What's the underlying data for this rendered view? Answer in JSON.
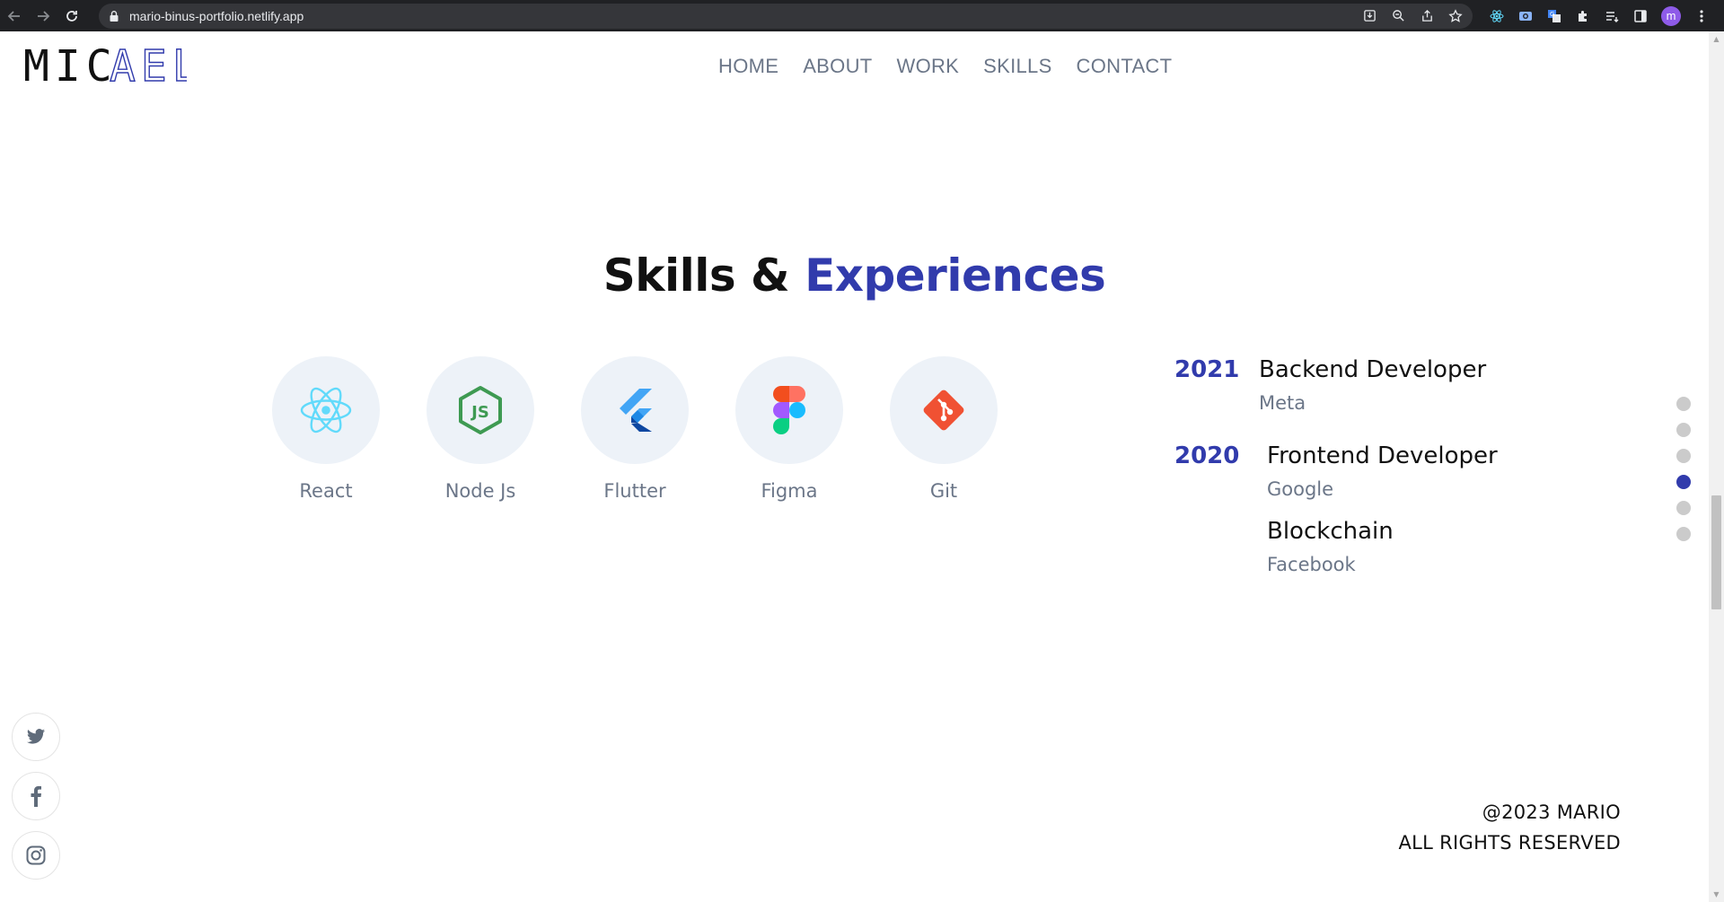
{
  "browser": {
    "url": "mario-binus-portfolio.netlify.app"
  },
  "logo": {
    "text_dark": "MIC",
    "text_accent": "AEL"
  },
  "nav": {
    "items": [
      {
        "label": "HOME"
      },
      {
        "label": "ABOUT"
      },
      {
        "label": "WORK"
      },
      {
        "label": "SKILLS"
      },
      {
        "label": "CONTACT"
      }
    ]
  },
  "section": {
    "title_main": "Skills &",
    "title_accent": "Experiences"
  },
  "skills": [
    {
      "name": "React",
      "icon": "react-icon"
    },
    {
      "name": "Node Js",
      "icon": "nodejs-icon"
    },
    {
      "name": "Flutter",
      "icon": "flutter-icon"
    },
    {
      "name": "Figma",
      "icon": "figma-icon"
    },
    {
      "name": "Git",
      "icon": "git-icon"
    }
  ],
  "experiences": [
    {
      "year": "2021",
      "works": [
        {
          "role": "Backend Developer",
          "company": "Meta"
        }
      ]
    },
    {
      "year": "2020",
      "works": [
        {
          "role": "Frontend Developer",
          "company": "Google"
        },
        {
          "role": "Blockchain",
          "company": "Facebook"
        }
      ]
    }
  ],
  "side_nav": {
    "active_index": 3,
    "count": 6
  },
  "social": [
    {
      "icon": "twitter-icon"
    },
    {
      "icon": "facebook-icon"
    },
    {
      "icon": "instagram-icon"
    }
  ],
  "footer": {
    "copyright": "@2023 MARIO",
    "rights": "ALL RIGHTS RESERVED"
  },
  "colors": {
    "accent": "#313bac",
    "muted": "#6b7688",
    "circle_bg": "#edf2f8"
  }
}
